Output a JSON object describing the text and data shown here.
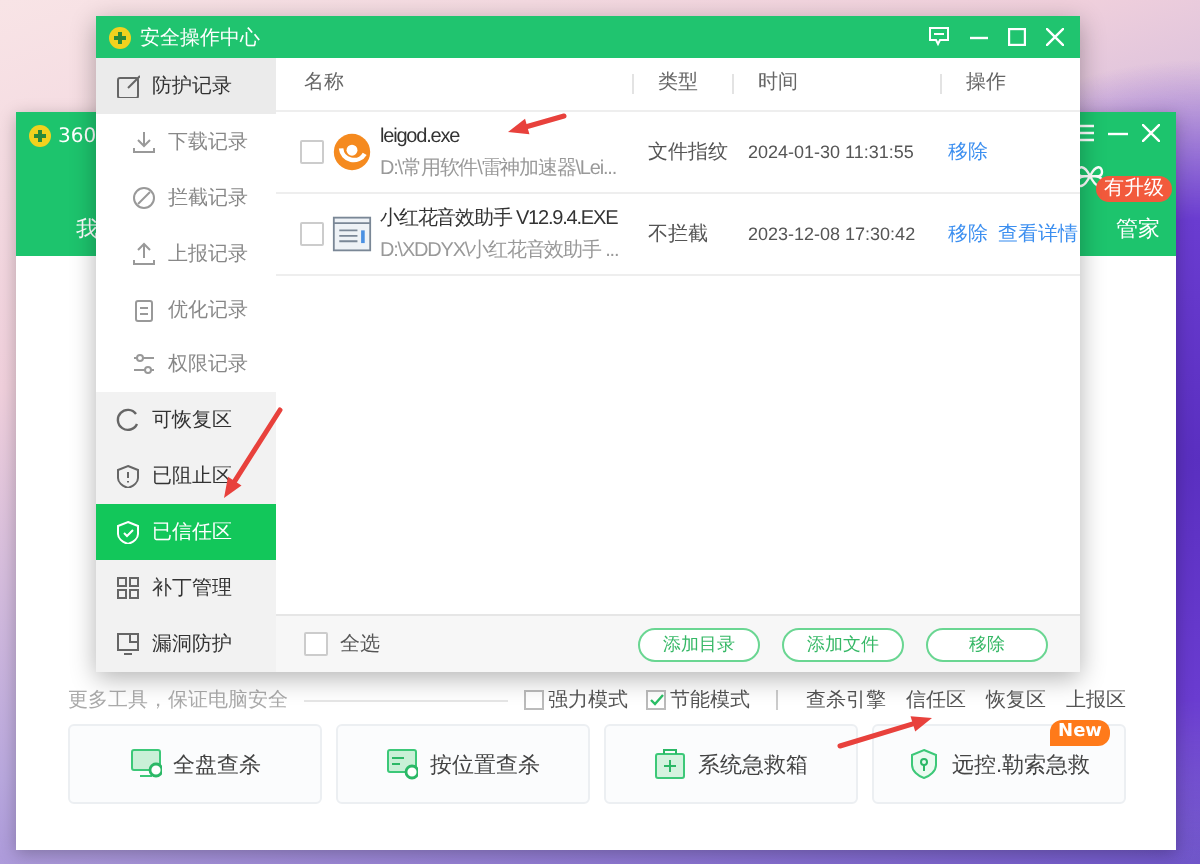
{
  "back_window": {
    "title": "360",
    "header_left": "我",
    "header_right": "管家",
    "upgrade_badge": "有升级",
    "tools_caption": "更多工具，保证电脑安全",
    "options": [
      {
        "label": "强力模式",
        "checked": false
      },
      {
        "label": "节能模式",
        "checked": true
      }
    ],
    "links": [
      "查杀引擎",
      "信任区",
      "恢复区",
      "上报区"
    ],
    "tools": [
      {
        "label": "全盘查杀"
      },
      {
        "label": "按位置查杀"
      },
      {
        "label": "系统急救箱"
      },
      {
        "label": "远控.勒索急救",
        "badge": "New"
      }
    ]
  },
  "window": {
    "title": "安全操作中心"
  },
  "sidebar": {
    "items": [
      {
        "label": "防护记录",
        "selected": false,
        "expanded": true,
        "children": [
          {
            "label": "下载记录",
            "selected": false
          },
          {
            "label": "拦截记录",
            "selected": false
          },
          {
            "label": "上报记录",
            "selected": false
          },
          {
            "label": "优化记录",
            "selected": false
          },
          {
            "label": "权限记录",
            "selected": false
          }
        ]
      },
      {
        "label": "可恢复区",
        "selected": false
      },
      {
        "label": "已阻止区",
        "selected": false
      },
      {
        "label": "已信任区",
        "selected": true
      },
      {
        "label": "补丁管理",
        "selected": false
      },
      {
        "label": "漏洞防护",
        "selected": false
      }
    ]
  },
  "table": {
    "columns": [
      "名称",
      "类型",
      "时间",
      "操作"
    ],
    "rows": [
      {
        "checked": false,
        "name": "leigod.exe",
        "path": "D:\\常用软件\\雷神加速器\\Lei...",
        "type": "文件指纹",
        "time": "2024-01-30 11:31:55",
        "actions": [
          "移除"
        ]
      },
      {
        "checked": false,
        "name": "小红花音效助手 V12.9.4.EXE",
        "path": "D:\\XDDYX\\小红花音效助手 ...",
        "type": "不拦截",
        "time": "2023-12-08 17:30:42",
        "actions": [
          "移除",
          "查看详情"
        ]
      }
    ]
  },
  "footer": {
    "select_all": {
      "label": "全选",
      "checked": false
    },
    "buttons": [
      "添加目录",
      "添加文件",
      "移除"
    ]
  }
}
